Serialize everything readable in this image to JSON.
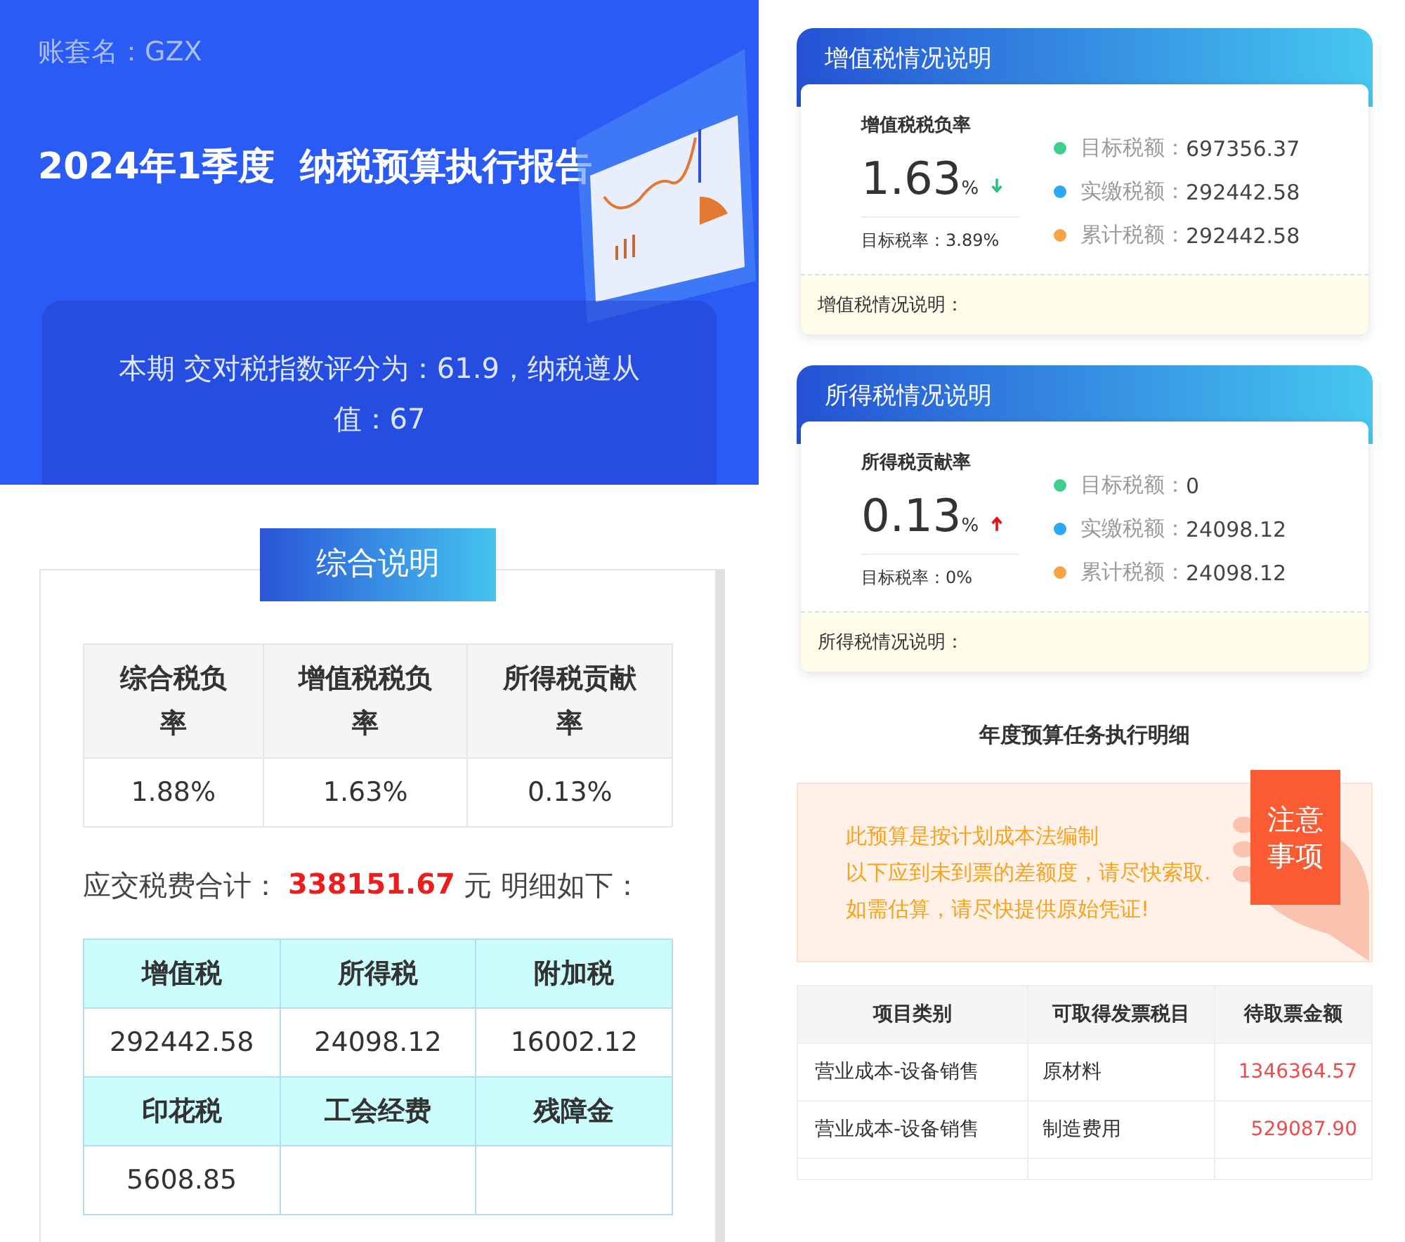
{
  "header": {
    "account": "账套名：GZX",
    "title": "2024年1季度  纳税预算执行报告",
    "score_text": "本期 交对税指数评分为：61.9，纳税遵从值：67"
  },
  "summary": {
    "tab": "综合说明",
    "rates_table": {
      "columns": [
        "综合税负率",
        "增值税税负率",
        "所得税贡献率"
      ],
      "values": [
        "1.88%",
        "1.63%",
        "0.13%"
      ]
    },
    "total": {
      "label": "应交税费合计：",
      "amount": "338151.67",
      "suffix": "元 明细如下："
    },
    "tax_table": [
      {
        "kind": "header",
        "cells": [
          "增值税",
          "所得税",
          "附加税"
        ]
      },
      {
        "kind": "value",
        "cells": [
          "292442.58",
          "24098.12",
          "16002.12"
        ]
      },
      {
        "kind": "header",
        "cells": [
          "印花税",
          "工会经费",
          "残障金"
        ]
      },
      {
        "kind": "value",
        "cells": [
          "5608.85"
        ]
      }
    ]
  },
  "tax_cards": [
    {
      "title": "增值税情况说明",
      "metric_label": "增值税税负率",
      "value": "1.63",
      "unit": "%",
      "rising": false,
      "target_rate": "目标税率：3.89%",
      "legend": [
        {
          "label": "目标税额：",
          "value": "697356.37",
          "color": "#3ccf8e"
        },
        {
          "label": "实缴税额：",
          "value": "292442.58",
          "color": "#2ba9f6"
        },
        {
          "label": "累计税额：",
          "value": "292442.58",
          "color": "#f7a543"
        }
      ],
      "note": "增值税情况说明："
    },
    {
      "title": "所得税情况说明",
      "metric_label": "所得税贡献率",
      "value": "0.13",
      "unit": "%",
      "rising": true,
      "target_rate": "目标税率：0%",
      "legend": [
        {
          "label": "目标税额：",
          "value": "0",
          "color": "#3ccf8e"
        },
        {
          "label": "实缴税额：",
          "value": "24098.12",
          "color": "#2ba9f6"
        },
        {
          "label": "累计税额：",
          "value": "24098.12",
          "color": "#f7a543"
        }
      ],
      "note": "所得税情况说明："
    }
  ],
  "budget": {
    "title": "年度预算任务执行明细",
    "notice": {
      "lines": [
        "此预算是按计划成本法编制",
        "以下应到未到票的差额度，请尽快索取.",
        "如需估算，请尽快提供原始凭证!"
      ],
      "badge": [
        "注意",
        "事项"
      ]
    },
    "table": {
      "columns": [
        "项目类别",
        "可取得发票税目",
        "待取票金额"
      ],
      "rows": [
        [
          "营业成本-设备销售",
          "原材料",
          "1346364.57"
        ],
        [
          "营业成本-设备销售",
          "制造费用",
          "529087.90"
        ]
      ]
    }
  }
}
